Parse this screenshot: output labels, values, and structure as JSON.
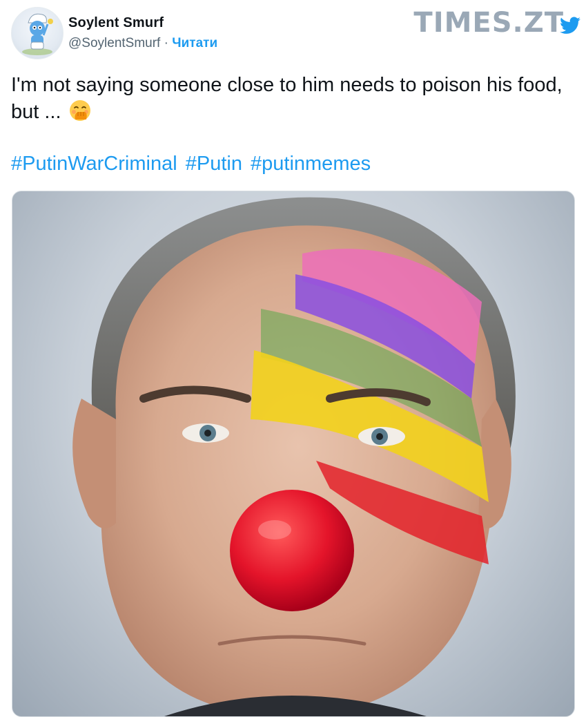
{
  "author": {
    "display_name": "Soylent Smurf",
    "handle": "@SoylentSmurf",
    "separator": "·",
    "follow_label": "Читати",
    "avatar_icon": "smurf-avatar-icon"
  },
  "watermark": {
    "text": "TIMES.ZT",
    "icon": "twitter-bird-icon",
    "color": "#9aa8b6"
  },
  "tweet": {
    "text": "I'm not saying someone close to him needs to poison his food, but ...",
    "emoji_icon": "face-with-hand-over-mouth-emoji",
    "hashtags": [
      "#PutinWarCriminal",
      "#Putin",
      "#putinmemes"
    ]
  },
  "media": {
    "kind": "photo",
    "icon": "clown-face-portrait-image"
  },
  "colors": {
    "link": "#1d9bf0",
    "text": "#0f1419",
    "secondary": "#536471"
  }
}
